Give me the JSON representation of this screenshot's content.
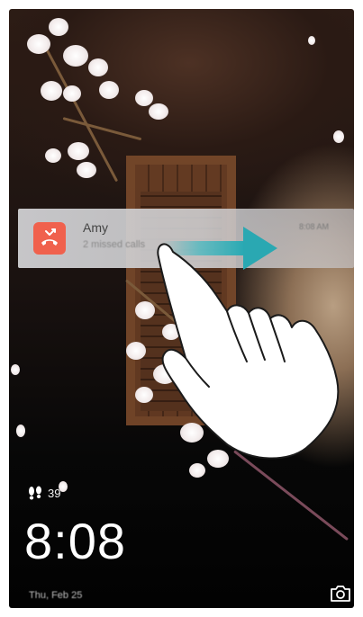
{
  "notification": {
    "title": "Amy",
    "subtitle": "2 missed calls",
    "time": "8:08 AM",
    "icon": "missed-call-icon",
    "icon_color": "#f0614d"
  },
  "gesture": {
    "arrow_color": "#3fb8c0",
    "direction": "swipe-right"
  },
  "lockscreen": {
    "steps": "39",
    "time": "8:08",
    "date": "Thu, Feb 25"
  },
  "shortcuts": {
    "camera_icon": "camera-icon"
  }
}
